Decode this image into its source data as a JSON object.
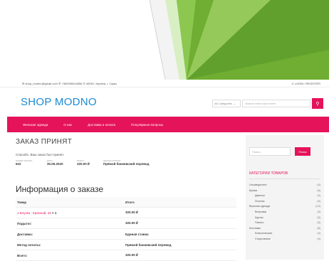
{
  "topbar": {
    "contacts": "✉ shop_modno@gmail.com  ✆ +380999044556  ⚲ 40030, Україна, г. Сумы",
    "login": "♙ LOGIN / REGISTER"
  },
  "header": {
    "logo": "SHOP MODNO",
    "category_select": "All Categories",
    "search_placeholder": "Search entire store here",
    "search_button": "🔍"
  },
  "nav": [
    "Женская одежда",
    "О нас",
    "Доставка и оплата",
    "Популярные вопросы"
  ],
  "order": {
    "title": "ЗАКАЗ ПРИНЯТ",
    "thanks": "Спасибо. Ваш заказ был принят.",
    "meta": [
      {
        "label": "НОМЕР ЗАКАЗА:",
        "value": "622"
      },
      {
        "label": "ДАТА:",
        "value": "30.05.2020"
      },
      {
        "label": "ВСЕГО:",
        "value": "320.00 ₽"
      },
      {
        "label": "МЕТОД ОПЛАТЫ:",
        "value": "Прямой банковский перевод"
      }
    ],
    "details_title": "Информация о заказе",
    "table": {
      "head": [
        "Товар",
        "Итого"
      ],
      "item": {
        "name": "1 Блузка - Красный, 44",
        "qty": "× 1",
        "total": "320.00 ₽"
      },
      "rows": [
        {
          "label": "Подытог:",
          "value": "320.00 ₽"
        },
        {
          "label": "Доставка:",
          "value": "Единая ставка"
        },
        {
          "label": "Метод оплаты:",
          "value": "Прямой банковский перевод"
        },
        {
          "label": "Всего:",
          "value": "320.00 ₽"
        }
      ]
    }
  },
  "sidebar": {
    "search_placeholder": "Поиск...",
    "search_button": "Поиск",
    "categories_title": "КАТЕГОРИИ ТОВАРОВ",
    "categories": [
      {
        "name": "Uncategorized",
        "count": "(0)",
        "sub": false
      },
      {
        "name": "Брюки",
        "count": "(6)",
        "sub": false
      },
      {
        "name": "Джинсы",
        "count": "(3)",
        "sub": true
      },
      {
        "name": "Лосины",
        "count": "(3)",
        "sub": true
      },
      {
        "name": "Верхняя одежда",
        "count": "(13)",
        "sub": false
      },
      {
        "name": "Ветровки",
        "count": "(3)",
        "sub": true
      },
      {
        "name": "Куртки",
        "count": "(5)",
        "sub": true
      },
      {
        "name": "Пальто",
        "count": "(5)",
        "sub": true
      },
      {
        "name": "Костюмы",
        "count": "(8)",
        "sub": false
      },
      {
        "name": "Классические",
        "count": "(4)",
        "sub": true
      },
      {
        "name": "Спортивные",
        "count": "(4)",
        "sub": true
      }
    ]
  },
  "colors": {
    "accent": "#e5135a",
    "logo": "#1b8ad4",
    "hero_green": "#7cb83a"
  }
}
